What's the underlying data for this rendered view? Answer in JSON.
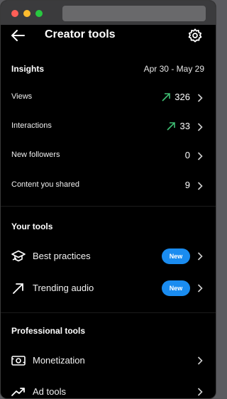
{
  "header": {
    "title": "Creator tools"
  },
  "insights": {
    "title": "Insights",
    "date_range": "Apr 30 - May 29",
    "rows": [
      {
        "label": "Views",
        "value": "326",
        "trend": "up"
      },
      {
        "label": "Interactions",
        "value": "33",
        "trend": "up"
      },
      {
        "label": "New followers",
        "value": "0"
      },
      {
        "label": "Content you shared",
        "value": "9"
      }
    ]
  },
  "your_tools": {
    "title": "Your tools",
    "items": [
      {
        "label": "Best practices",
        "badge": "New",
        "icon": "graduation-cap-icon"
      },
      {
        "label": "Trending audio",
        "badge": "New",
        "icon": "trending-arrow-icon"
      }
    ]
  },
  "professional_tools": {
    "title": "Professional tools",
    "items": [
      {
        "label": "Monetization",
        "icon": "money-icon"
      },
      {
        "label": "Ad tools",
        "icon": "trend-line-icon"
      }
    ]
  },
  "colors": {
    "background": "#000000",
    "trend_arrow": "#3fbf74",
    "badge": "#1a8cf0",
    "titlebar": "#3b3b3d"
  }
}
